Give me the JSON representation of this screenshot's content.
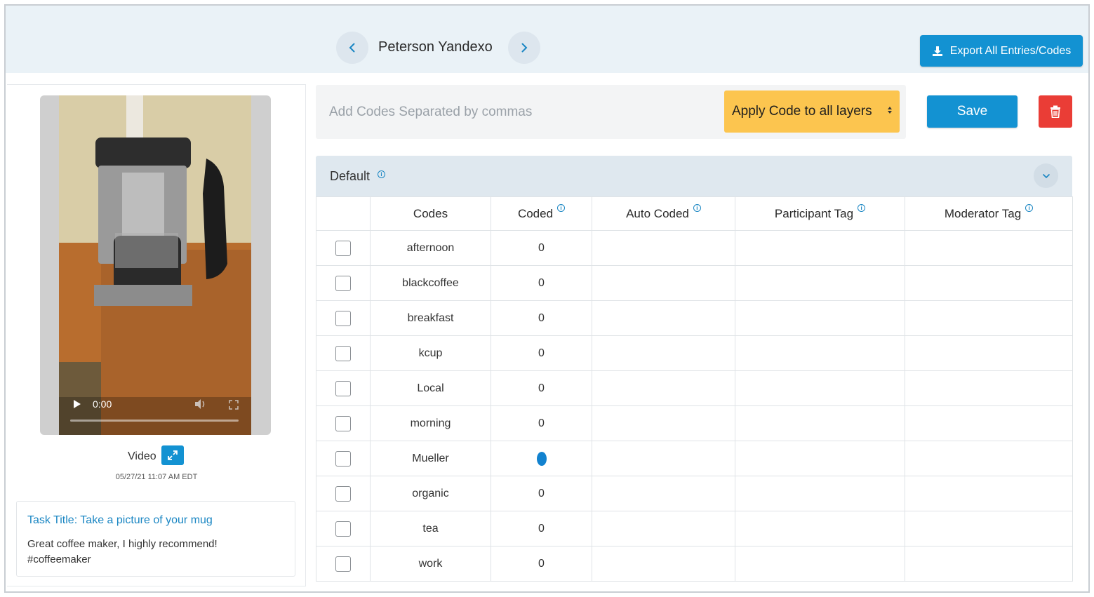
{
  "header": {
    "participant_name": "Peterson Yandexo",
    "export_label": "Export All Entries/Codes",
    "prev_icon": "chevron-left-icon",
    "next_icon": "chevron-right-icon",
    "accent_color": "#1392d2"
  },
  "media": {
    "time": "0:00",
    "label": "Video",
    "date": "05/27/21 11:07 AM EDT"
  },
  "task": {
    "title": "Task Title: Take a picture of your mug",
    "text": "Great coffee maker, I highly recommend! #coffeemaker"
  },
  "coding": {
    "input_placeholder": "Add Codes Separated by commas",
    "input_value": "",
    "apply_option": "Apply Code to all layers",
    "save_label": "Save",
    "apply_color": "#fcc54f",
    "delete_color": "#ea3d36"
  },
  "layer": {
    "name": "Default"
  },
  "table": {
    "columns": [
      "",
      "Codes",
      "Coded",
      "Auto Coded",
      "Participant Tag",
      "Moderator Tag"
    ],
    "rows": [
      {
        "code": "afternoon",
        "coded": "0"
      },
      {
        "code": "blackcoffee",
        "coded": "0"
      },
      {
        "code": "breakfast",
        "coded": "0"
      },
      {
        "code": "kcup",
        "coded": "0"
      },
      {
        "code": "Local",
        "coded": "0"
      },
      {
        "code": "morning",
        "coded": "0"
      },
      {
        "code": "Mueller",
        "coded": ""
      },
      {
        "code": "organic",
        "coded": "0"
      },
      {
        "code": "tea",
        "coded": "0"
      },
      {
        "code": "work",
        "coded": "0"
      }
    ]
  }
}
